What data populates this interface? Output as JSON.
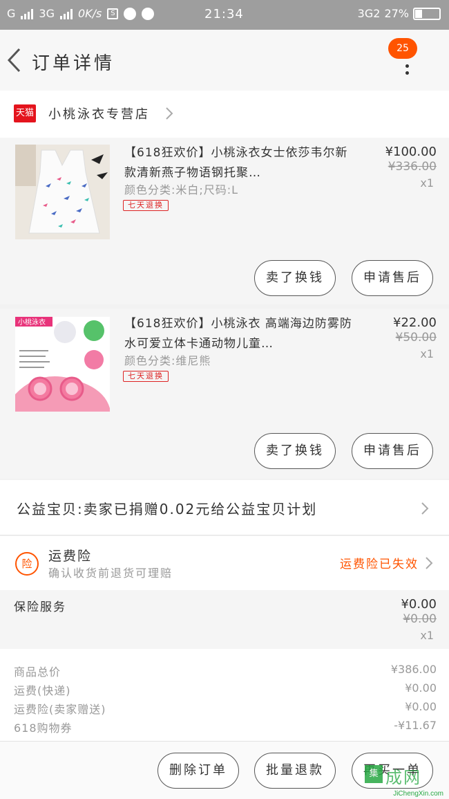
{
  "status_bar": {
    "carrier_left": "G",
    "network": "3G",
    "speed": "0K/s",
    "time": "21:34",
    "network_right": "3G2",
    "battery": "27%"
  },
  "header": {
    "title": "订单详情",
    "badge_count": "25"
  },
  "store": {
    "badge": "天猫",
    "name": "小桃泳衣专营店"
  },
  "items": [
    {
      "title": "【618狂欢价】小桃泳衣女士依莎韦尔新款清新燕子物语钢托聚…",
      "sku": "颜色分类:米白;尺码:L",
      "tag": "七天退换",
      "price": "¥100.00",
      "original_price": "¥336.00",
      "quantity": "x1",
      "btn_primary": "卖了换钱",
      "btn_secondary": "申请售后"
    },
    {
      "title": "【618狂欢价】小桃泳衣 高端海边防雾防水可爱立体卡通动物儿童…",
      "sku": "颜色分类:维尼熊",
      "tag": "七天退换",
      "image_label": "小桃泳衣",
      "price": "¥22.00",
      "original_price": "¥50.00",
      "quantity": "x1",
      "btn_primary": "卖了换钱",
      "btn_secondary": "申请售后"
    }
  ],
  "charity": {
    "text": "公益宝贝:卖家已捐赠0.02元给公益宝贝计划"
  },
  "freight_insurance": {
    "icon_label": "险",
    "name": "运费险",
    "desc": "确认收货前退货可理赔",
    "status": "运费险已失效"
  },
  "insurance_service": {
    "name": "保险服务",
    "price": "¥0.00",
    "original_price": "¥0.00",
    "quantity": "x1"
  },
  "summary": [
    {
      "label": "商品总价",
      "value": "¥386.00"
    },
    {
      "label": "运费(快递)",
      "value": "¥0.00"
    },
    {
      "label": "运费险(卖家赠送)",
      "value": "¥0.00"
    },
    {
      "label": "618购物券",
      "value": "-¥11.67"
    }
  ],
  "bottom_bar": {
    "delete": "删除订单",
    "batch_refund": "批量退款",
    "third": "再买一单"
  },
  "watermark": {
    "logo": "集",
    "big": "成网",
    "small": "JiChengXin.com"
  },
  "colors": {
    "accent": "#ff5400",
    "tmall_red": "#e4141d",
    "status_bar": "#9e9e9e"
  }
}
